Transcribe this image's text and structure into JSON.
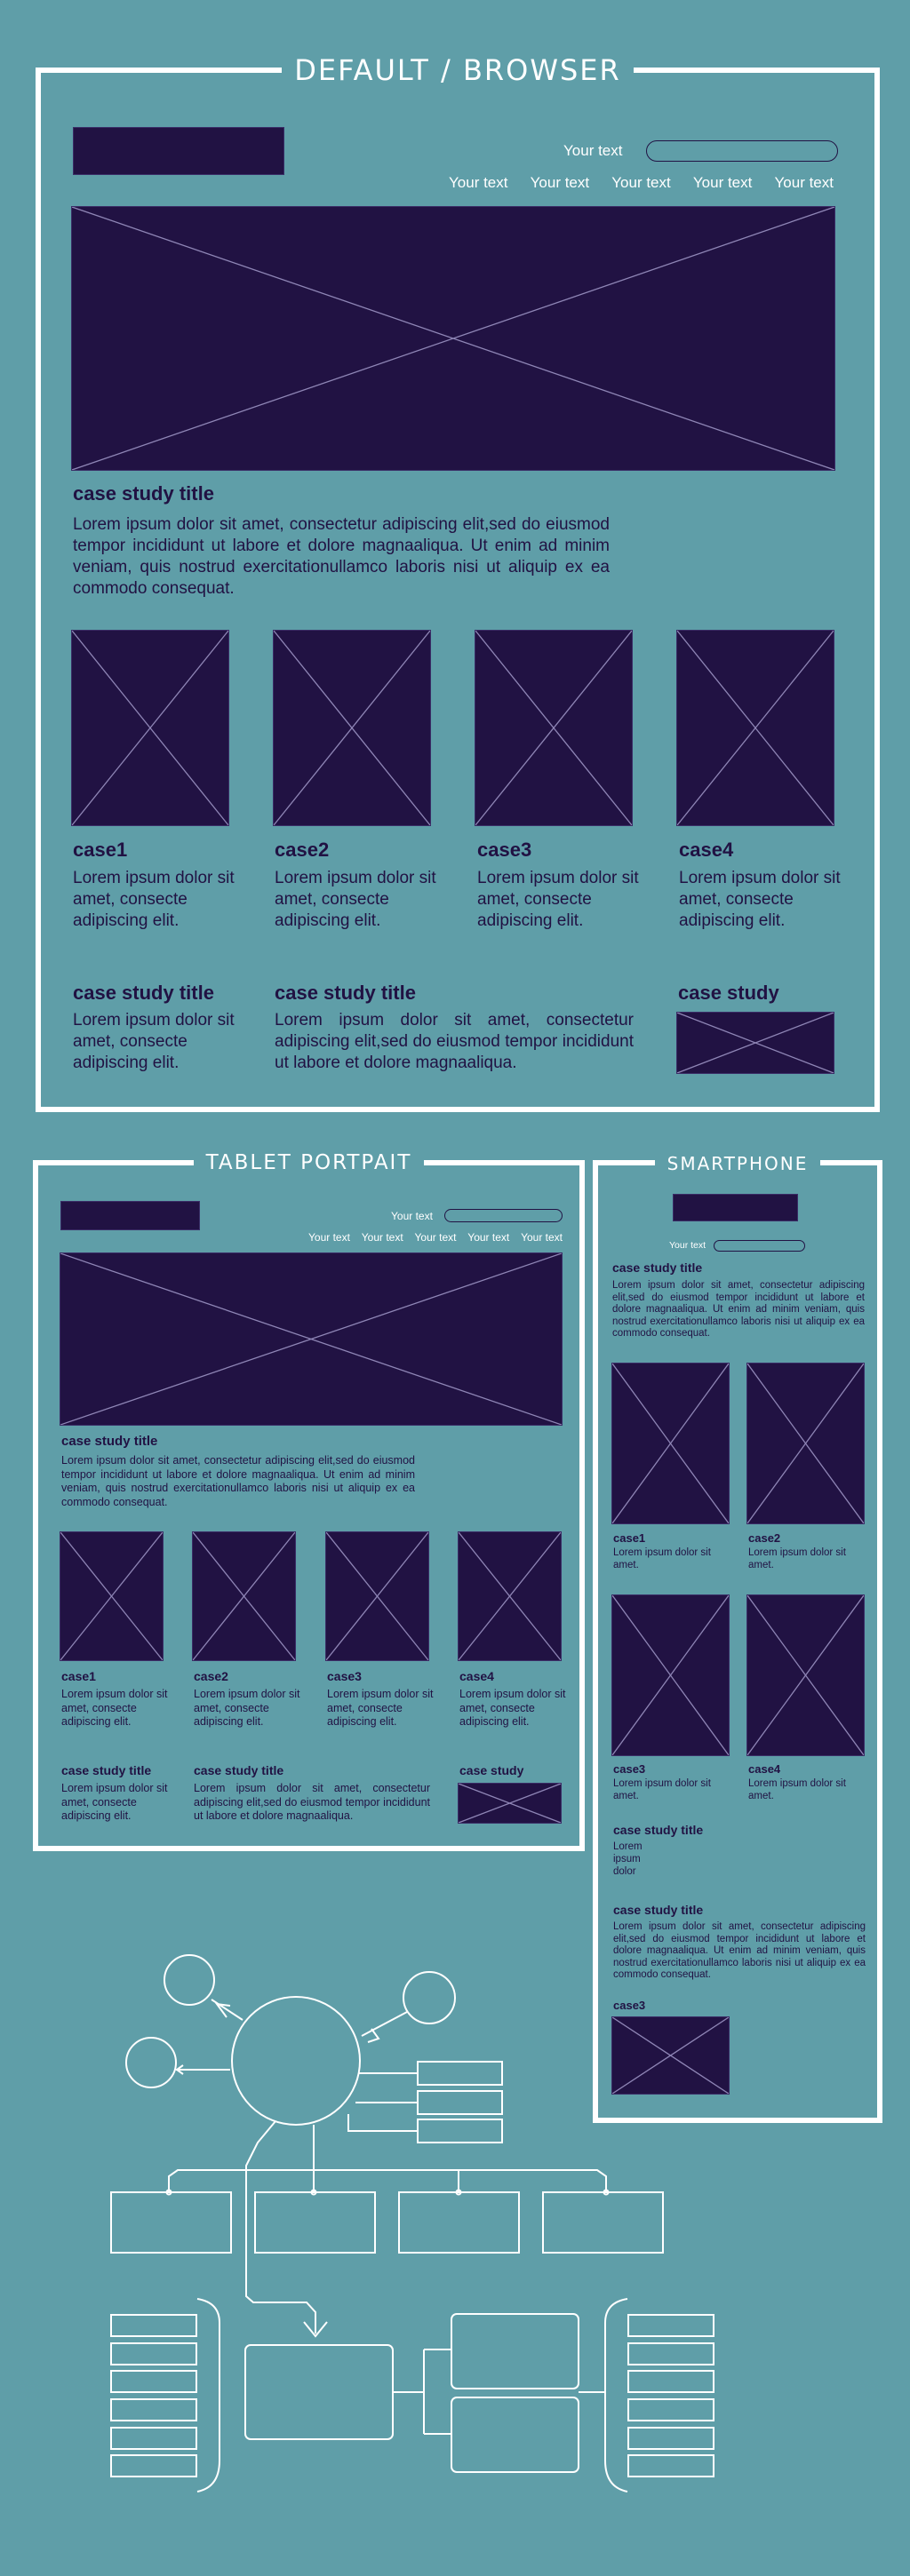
{
  "browser": {
    "title": "DEFAULT / BROWSER",
    "header_text": "Your text",
    "nav": [
      "Your text",
      "Your text",
      "Your text",
      "Your text",
      "Your text"
    ],
    "case_study_title": "case study title",
    "case_study_body": "Lorem ipsum dolor sit amet, consectetur adipiscing elit,sed do eiusmod tempor incididunt ut labore et dolore magnaaliqua. Ut enim ad minim veniam, quis nostrud exercitationullamco laboris nisi ut aliquip ex ea commodo consequat.",
    "cases": [
      {
        "title": "case1",
        "body": "Lorem ipsum dolor sit amet, consecte adipiscing elit."
      },
      {
        "title": "case2",
        "body": "Lorem ipsum dolor sit amet, consecte adipiscing elit."
      },
      {
        "title": "case3",
        "body": "Lorem ipsum dolor sit amet, consecte adipiscing elit."
      },
      {
        "title": "case4",
        "body": "Lorem ipsum dolor sit amet, consecte adipiscing elit."
      }
    ],
    "footer": {
      "col1_title": "case study title",
      "col1_body": "Lorem ipsum dolor sit amet, consecte adipiscing elit.",
      "col2_title": "case study title",
      "col2_body": "Lorem ipsum dolor sit amet, consectetur adipiscing elit,sed do eiusmod tempor incididunt ut labore et dolore magnaaliqua.",
      "col3_title": "case study"
    }
  },
  "tablet": {
    "title": "TABLET PORTPAIT",
    "header_text": "Your text",
    "nav": [
      "Your text",
      "Your text",
      "Your text",
      "Your text",
      "Your text"
    ],
    "case_study_title": "case study title",
    "case_study_body": "Lorem ipsum dolor sit amet, consectetur adipiscing elit,sed do eiusmod tempor incididunt ut labore et dolore magnaaliqua. Ut enim ad minim veniam, quis nostrud exercitationullamco laboris nisi ut aliquip ex ea commodo consequat.",
    "cases": [
      {
        "title": "case1",
        "body": "Lorem ipsum dolor sit amet, consecte adipiscing elit."
      },
      {
        "title": "case2",
        "body": "Lorem ipsum dolor sit amet, consecte adipiscing elit."
      },
      {
        "title": "case3",
        "body": "Lorem ipsum dolor sit amet, consecte adipiscing elit."
      },
      {
        "title": "case4",
        "body": "Lorem ipsum dolor sit amet, consecte adipiscing elit."
      }
    ],
    "footer": {
      "col1_title": "case study title",
      "col1_body": "Lorem ipsum dolor sit amet, consecte adipiscing elit.",
      "col2_title": "case study title",
      "col2_body": "Lorem ipsum dolor sit amet, consectetur adipiscing elit,sed do eiusmod tempor incididunt ut labore et dolore magnaaliqua.",
      "col3_title": "case study"
    }
  },
  "phone": {
    "title": "SMARTPHONE",
    "header_text": "Your text",
    "case_study_title": "case study title",
    "case_study_body": "Lorem ipsum dolor sit amet, consectetur adipiscing elit,sed do eiusmod tempor incididunt ut labore et dolore magnaaliqua. Ut enim ad minim veniam, quis nostrud exercitationullamco laboris nisi ut aliquip ex ea commodo consequat.",
    "cases": [
      {
        "title": "case1",
        "body": "Lorem ipsum dolor sit amet."
      },
      {
        "title": "case2",
        "body": "Lorem ipsum dolor sit amet."
      },
      {
        "title": "case3",
        "body": "Lorem ipsum dolor sit amet."
      },
      {
        "title": "case4",
        "body": "Lorem ipsum dolor sit amet."
      }
    ],
    "block1_title": "case study title",
    "block1_body": "Lorem ipsum dolor",
    "block2_title": "case study title",
    "block2_body": "Lorem ipsum dolor sit amet, consectetur adipiscing elit,sed do eiusmod tempor incididunt ut labore et dolore magnaaliqua. Ut enim ad minim veniam, quis nostrud exercitationullamco laboris nisi ut aliquip ex ea commodo consequat.",
    "block3_title": "case3"
  },
  "colors": {
    "background": "#5f9ea8",
    "placeholder": "#211243",
    "frame": "#ffffff"
  }
}
